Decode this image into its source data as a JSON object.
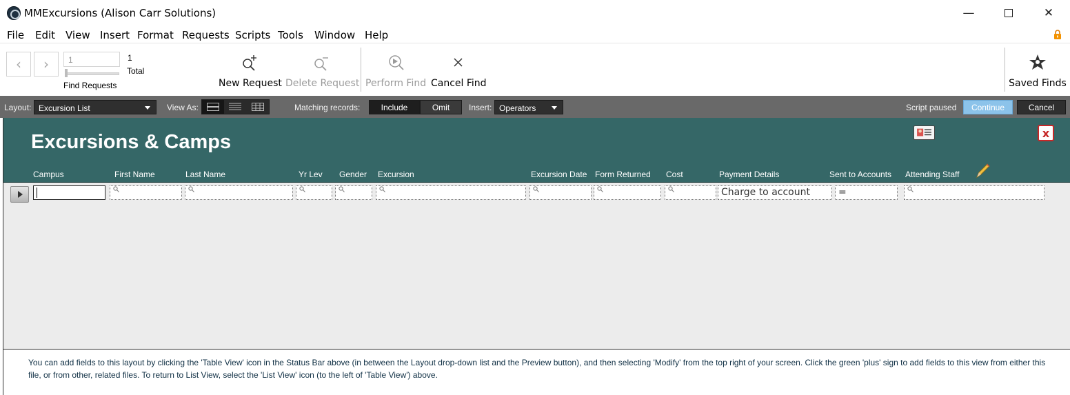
{
  "window": {
    "title": "MMExcursions (Alison Carr Solutions)",
    "controls": {
      "minimize": "—",
      "maximize": "",
      "close": "✕"
    }
  },
  "menu": [
    "File",
    "Edit",
    "View",
    "Insert",
    "Format",
    "Requests",
    "Scripts",
    "Tools",
    "Window",
    "Help"
  ],
  "toolbar": {
    "record_value": "1",
    "found_count": "1",
    "total_label": "Total",
    "find_requests_label": "Find Requests",
    "new_request": "New Request",
    "delete_request": "Delete Request",
    "perform_find": "Perform Find",
    "cancel_find": "Cancel Find",
    "saved_finds": "Saved Finds"
  },
  "statusbar": {
    "layout_label": "Layout:",
    "layout_value": "Excursion List",
    "view_as_label": "View As:",
    "view_as_active": "form",
    "matching_label": "Matching records:",
    "include_label": "Include",
    "omit_label": "Omit",
    "insert_label": "Insert:",
    "insert_value": "Operators",
    "script_paused": "Script paused",
    "continue_label": "Continue",
    "cancel_label": "Cancel"
  },
  "layout": {
    "title": "Excursions & Camps",
    "columns": [
      "Campus",
      "First Name",
      "Last Name",
      "Yr Lev",
      "Gender",
      "Excursion",
      "Excursion Date",
      "Form Returned",
      "Cost",
      "Payment Details",
      "Sent to Accounts",
      "Attending Staff"
    ],
    "find_row": {
      "campus": "",
      "payment_details": "Charge to account",
      "sent_to_accounts": "="
    },
    "footer_note": "You can add fields to this layout by clicking the 'Table View' icon in the Status Bar above (in between the Layout drop-down list and the Preview button), and then selecting 'Modify' from the top right of your screen.  Click the green 'plus' sign to add fields to this view from either this file, or from other, related files.  To return to List View, select the 'List View' icon (to the left of 'Table View') above."
  },
  "colors": {
    "header_band": "#356767",
    "status_bar": "#696969",
    "continue_button": "#8cc3ea",
    "close_button_red": "#c62828"
  }
}
